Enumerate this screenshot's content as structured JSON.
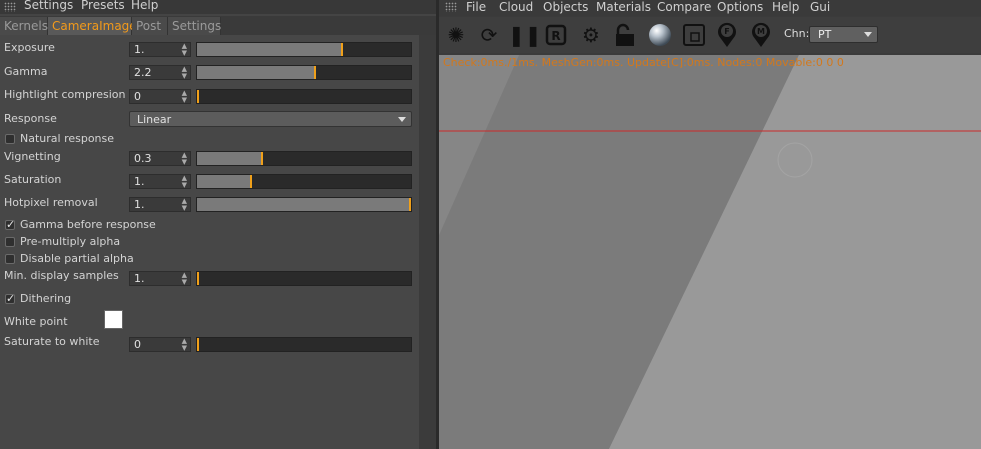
{
  "left_menu": [
    "Settings",
    "Presets",
    "Help"
  ],
  "tabs": [
    "Kernels",
    "CameraImager",
    "Post",
    "Settings"
  ],
  "exposure": {
    "label": "Exposure",
    "value": "1.",
    "fill": 0.68
  },
  "gamma": {
    "label": "Gamma",
    "value": "2.2",
    "fill": 0.55
  },
  "highlight": {
    "label": "Hightlight compresion",
    "value": "0",
    "fill": 0.0
  },
  "response": {
    "label": "Response",
    "value": "Linear"
  },
  "natural_response": {
    "label": "Natural response",
    "checked": false
  },
  "vignetting": {
    "label": "Vignetting",
    "value": "0.3",
    "fill": 0.3
  },
  "saturation": {
    "label": "Saturation",
    "value": "1.",
    "fill": 0.25
  },
  "hotpixel": {
    "label": "Hotpixel removal",
    "value": "1.",
    "fill": 1.0
  },
  "gamma_before_response": {
    "label": "Gamma before response",
    "checked": true
  },
  "premultiply": {
    "label": "Pre-multiply alpha",
    "checked": false
  },
  "disable_partial": {
    "label": "Disable partial alpha",
    "checked": false
  },
  "min_samples": {
    "label": "Min. display samples",
    "value": "1.",
    "fill": 0.0
  },
  "dithering": {
    "label": "Dithering",
    "checked": true
  },
  "white_point": {
    "label": "White point",
    "color": "#ffffff"
  },
  "saturate_white": {
    "label": "Saturate to white",
    "value": "0",
    "fill": 0.0
  },
  "right_menu": [
    "File",
    "Cloud",
    "Objects",
    "Materials",
    "Compare",
    "Options",
    "Help",
    "Gui"
  ],
  "toolbar_icons": [
    "aperture-icon",
    "refresh-icon",
    "pause-icon",
    "region-render-icon",
    "gear-icon",
    "unlock-icon",
    "material-ball-icon",
    "resize-icon",
    "focus-pick-icon",
    "material-pick-icon"
  ],
  "channel": {
    "label": "Chn:",
    "value": "PT"
  },
  "stats": "Check:0ms./1ms. MeshGen:0ms. Update[C]:0ms. Nodes:0 Movable:0  0 0",
  "colors": {
    "accent": "#f29a1b",
    "slider_marker": "#f0a01a",
    "stats_text": "#d2781c",
    "viewport_line": "#cc2a2a"
  }
}
